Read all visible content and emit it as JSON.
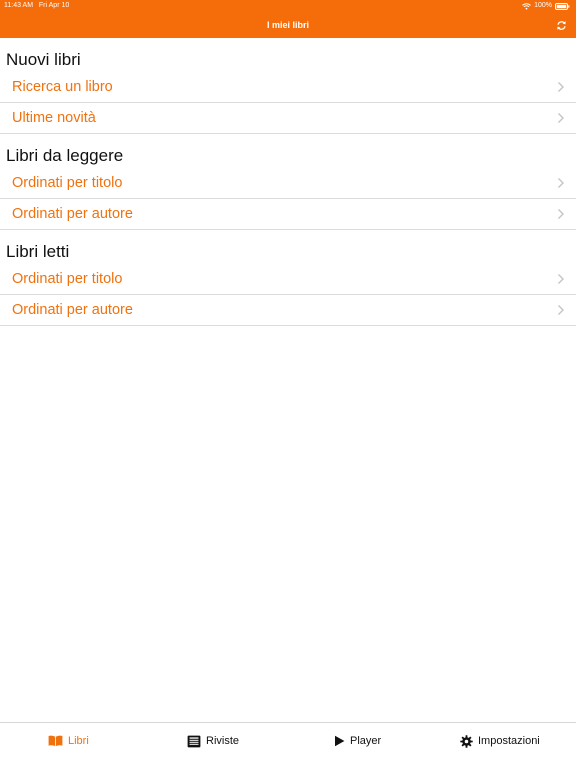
{
  "status_bar": {
    "time": "11:43 AM",
    "date": "Fri Apr 10",
    "battery": "100%",
    "wifi_icon": "wifi-icon",
    "battery_icon": "battery-icon"
  },
  "nav": {
    "title": "I miei libri",
    "refresh_icon": "refresh-icon"
  },
  "sections": [
    {
      "title": "Nuovi libri",
      "items": [
        {
          "label": "Ricerca un libro"
        },
        {
          "label": "Ultime novità"
        }
      ]
    },
    {
      "title": "Libri da leggere",
      "items": [
        {
          "label": "Ordinati per titolo"
        },
        {
          "label": "Ordinati per autore"
        }
      ]
    },
    {
      "title": "Libri letti",
      "items": [
        {
          "label": "Ordinati per titolo"
        },
        {
          "label": "Ordinati per autore"
        }
      ]
    }
  ],
  "tabs": [
    {
      "label": "Libri",
      "icon": "book-icon",
      "active": true
    },
    {
      "label": "Riviste",
      "icon": "newspaper-icon",
      "active": false
    },
    {
      "label": "Player",
      "icon": "play-icon",
      "active": false
    },
    {
      "label": "Impostazioni",
      "icon": "gear-icon",
      "active": false
    }
  ],
  "colors": {
    "accent": "#f56d0a",
    "link": "#f0720f",
    "separator": "#dcdcdc"
  }
}
